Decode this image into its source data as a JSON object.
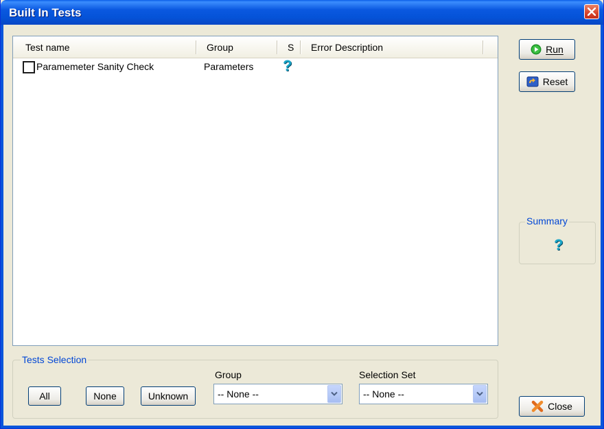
{
  "window": {
    "title": "Built In Tests"
  },
  "list": {
    "columns": {
      "name": "Test name",
      "group": "Group",
      "status": "S",
      "error": "Error Description"
    },
    "rows": [
      {
        "name": "Paramemeter Sanity Check",
        "group": "Parameters",
        "status": "?",
        "error": ""
      }
    ]
  },
  "buttons": {
    "run": "Run",
    "reset": "Reset",
    "close": "Close",
    "all": "All",
    "none": "None",
    "unknown": "Unknown"
  },
  "summary": {
    "legend": "Summary",
    "status": "?"
  },
  "selection": {
    "legend": "Tests Selection",
    "group_label": "Group",
    "group_value": "-- None --",
    "set_label": "Selection Set",
    "set_value": "-- None --"
  },
  "colors": {
    "title_bar": "#0a58e0",
    "status_question": "#1aa7c9",
    "legend_text": "#0046d5"
  }
}
